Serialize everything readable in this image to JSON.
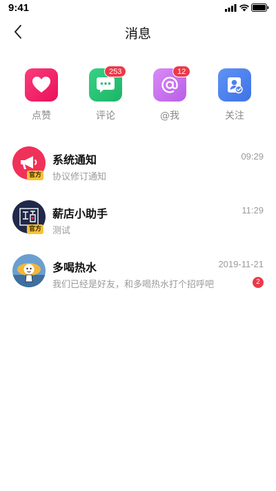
{
  "status_bar": {
    "time": "9:41",
    "icons": [
      "signal-icon",
      "wifi-icon",
      "battery-icon"
    ]
  },
  "nav": {
    "title": "消息",
    "back_icon": "chevron-left-icon"
  },
  "quick_actions": [
    {
      "label": "点赞",
      "icon": "heart-icon",
      "color": "#f0266a",
      "badge": ""
    },
    {
      "label": "评论",
      "icon": "comment-icon",
      "color": "#25c174",
      "badge": "253"
    },
    {
      "label": "@我",
      "icon": "at-icon",
      "color": "#c56df0",
      "badge": "12"
    },
    {
      "label": "关注",
      "icon": "user-check-icon",
      "color": "#4d82f0",
      "badge": ""
    }
  ],
  "messages": [
    {
      "title": "系统通知",
      "time": "09:29",
      "preview": "协议修订通知",
      "official_tag": "官方",
      "unread": ""
    },
    {
      "title": "薪店小助手",
      "time": "11:29",
      "preview": "测试",
      "official_tag": "官方",
      "unread": ""
    },
    {
      "title": "多喝热水",
      "time": "2019-11-21",
      "preview": "我们已经是好友，和多喝热水打个招呼吧",
      "official_tag": "",
      "unread": "2"
    }
  ],
  "colors": {
    "badge_red": "#ea3a4a",
    "official_yellow": "#f7c234"
  }
}
